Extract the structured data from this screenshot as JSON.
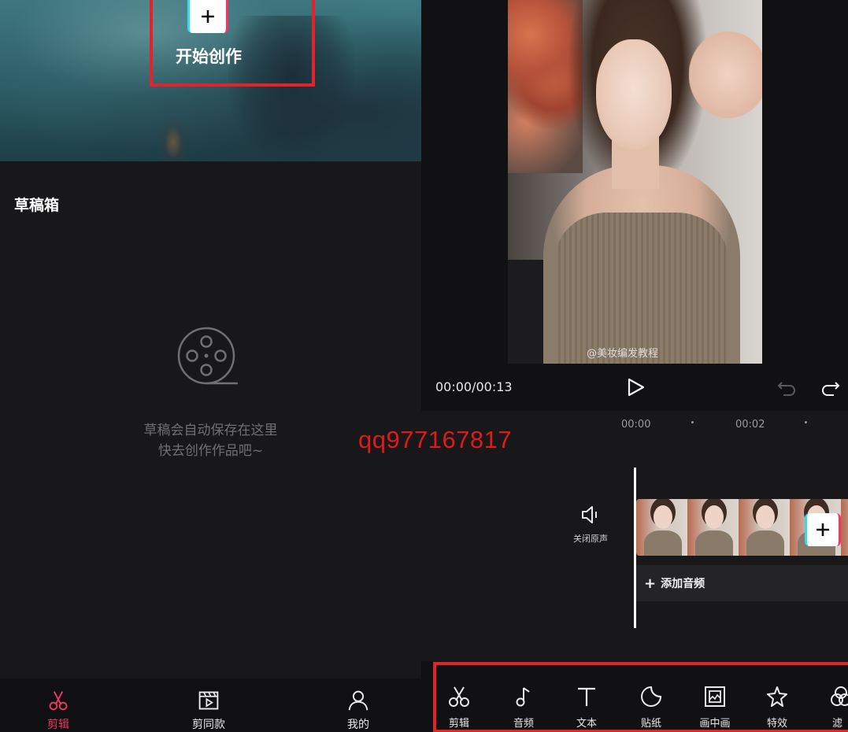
{
  "colors": {
    "accent": "#e8395f",
    "highlight_box": "#e0242a",
    "watermark": "#e01a1a",
    "background": "#18181a"
  },
  "left": {
    "hero": {
      "add_icon": "plus-icon",
      "start_label": "开始创作"
    },
    "drafts": {
      "title": "草稿箱",
      "empty_icon": "film-reel-icon",
      "empty_line1": "草稿会自动保存在这里",
      "empty_line2": "快去创作作品吧~"
    },
    "bottom_nav": [
      {
        "label": "剪辑",
        "icon": "scissors-icon",
        "active": true
      },
      {
        "label": "剪同款",
        "icon": "clapperboard-icon",
        "active": false
      },
      {
        "label": "我的",
        "icon": "person-icon",
        "active": false
      }
    ]
  },
  "watermark": "qq977167817",
  "right": {
    "video_watermark": "@美妆编发教程",
    "time_display": "00:00/00:13",
    "ruler": [
      "00:00",
      "00:02"
    ],
    "mute_label": "关闭原声",
    "add_audio_label": "添加音频",
    "toolbar": [
      {
        "label": "剪辑",
        "icon": "scissors-icon"
      },
      {
        "label": "音频",
        "icon": "music-note-icon"
      },
      {
        "label": "文本",
        "icon": "text-icon"
      },
      {
        "label": "贴纸",
        "icon": "sticker-icon"
      },
      {
        "label": "画中画",
        "icon": "picture-in-picture-icon"
      },
      {
        "label": "特效",
        "icon": "sparkle-star-icon"
      },
      {
        "label": "滤",
        "icon": "filter-icon"
      }
    ]
  }
}
